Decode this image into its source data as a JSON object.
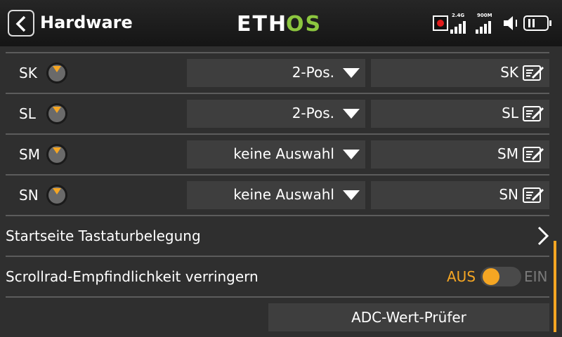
{
  "header": {
    "title": "Hardware",
    "logo_left": "ETH",
    "logo_right": "OS",
    "rf_1_label": "2.4G",
    "rf_2_label": "900M"
  },
  "colors": {
    "accent": "#f5a623",
    "logo_green": "#8cc63f",
    "record_red": "#e01b1b",
    "field_bg": "#3e3e3e",
    "page_bg": "#2f2f2f"
  },
  "switch_rows": [
    {
      "name": "SK",
      "type": "2-Pos.",
      "label": "SK"
    },
    {
      "name": "SL",
      "type": "2-Pos.",
      "label": "SL"
    },
    {
      "name": "SM",
      "type": "keine Auswahl",
      "label": "SM"
    },
    {
      "name": "SN",
      "type": "keine Auswahl",
      "label": "SN"
    }
  ],
  "menu": {
    "home_keys": "Startseite Tastaturbelegung",
    "scroll_sensitivity": "Scrollrad-Empfindlichkeit verringern",
    "toggle_off": "AUS",
    "toggle_on": "EIN",
    "toggle_state": "AUS",
    "adc_button": "ADC-Wert-Prüfer"
  },
  "icons": {
    "back": "chevron-left-icon",
    "record": "record-icon",
    "signal": "signal-bars-icon",
    "volume": "speaker-icon",
    "battery": "battery-icon",
    "dropdown": "triangle-down-icon",
    "edit": "edit-icon",
    "submenu": "chevron-right-icon"
  }
}
